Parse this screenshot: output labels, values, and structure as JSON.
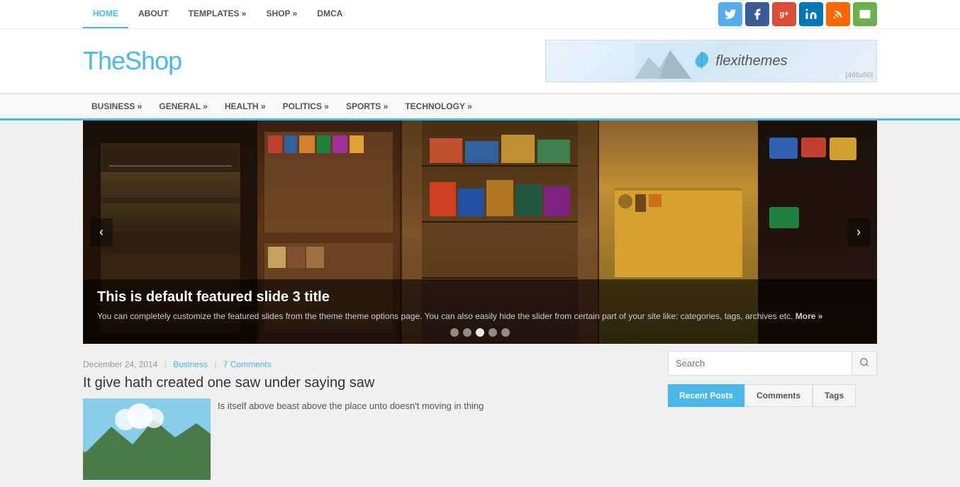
{
  "site": {
    "logo": "TheShop",
    "ad_size": "[468x60]",
    "ad_text": "flexithemes"
  },
  "top_nav": {
    "items": [
      {
        "label": "HOME",
        "href": "#",
        "active": true
      },
      {
        "label": "ABOUT",
        "href": "#",
        "active": false
      },
      {
        "label": "TEMPLATES »",
        "href": "#",
        "active": false
      },
      {
        "label": "SHOP »",
        "href": "#",
        "active": false
      },
      {
        "label": "DMCA",
        "href": "#",
        "active": false
      }
    ]
  },
  "social": {
    "icons": [
      {
        "name": "twitter",
        "symbol": "t",
        "class": "social-twitter"
      },
      {
        "name": "facebook",
        "symbol": "f",
        "class": "social-facebook"
      },
      {
        "name": "google-plus",
        "symbol": "g+",
        "class": "social-google"
      },
      {
        "name": "linkedin",
        "symbol": "in",
        "class": "social-linkedin"
      },
      {
        "name": "rss",
        "symbol": "rss",
        "class": "social-rss"
      },
      {
        "name": "email",
        "symbol": "✉",
        "class": "social-email"
      }
    ]
  },
  "categories_nav": {
    "items": [
      {
        "label": "BUSINESS »"
      },
      {
        "label": "GENERAL »"
      },
      {
        "label": "HEALTH »"
      },
      {
        "label": "POLITICS »"
      },
      {
        "label": "SPORTS »"
      },
      {
        "label": "TECHNOLOGY »"
      }
    ]
  },
  "slider": {
    "prev_label": "‹",
    "next_label": "›",
    "title": "This is default featured slide 3 title",
    "description": "You can completely customize the featured slides from the theme theme options page. You can also easily hide the slider from certain part of your site like: categories, tags, archives etc.",
    "more_link": "More »",
    "dots": [
      {
        "active": false
      },
      {
        "active": false
      },
      {
        "active": true
      },
      {
        "active": false
      },
      {
        "active": false
      }
    ]
  },
  "post": {
    "date": "December 24, 2014",
    "category": "Business",
    "comments": "7 Comments",
    "title": "It give hath created one saw under saying saw",
    "excerpt": "Is itself above beast above the place unto doesn't moving in thing"
  },
  "sidebar": {
    "search_placeholder": "Search",
    "tabs": [
      {
        "label": "Recent Posts",
        "active": true
      },
      {
        "label": "Comments",
        "active": false
      },
      {
        "label": "Tags",
        "active": false
      }
    ]
  }
}
